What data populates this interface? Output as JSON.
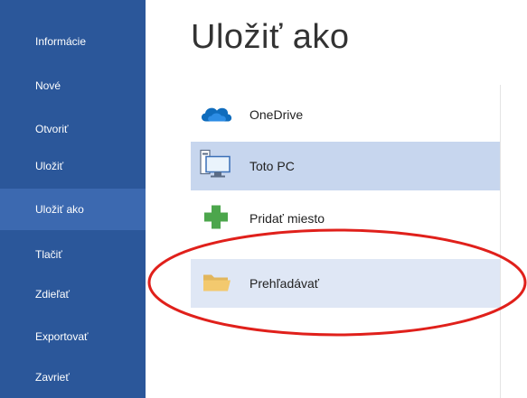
{
  "sidebar": {
    "items": [
      {
        "label": "Informácie"
      },
      {
        "label": "Nové"
      },
      {
        "label": "Otvoriť"
      },
      {
        "label": "Uložiť"
      },
      {
        "label": "Uložiť ako"
      },
      {
        "label": "Tlačiť"
      },
      {
        "label": "Zdieľať"
      },
      {
        "label": "Exportovať"
      },
      {
        "label": "Zavrieť"
      }
    ],
    "active": "Uložiť ako",
    "color": "#2b579a"
  },
  "main": {
    "title": "Uložiť ako",
    "locations": [
      {
        "label": "OneDrive",
        "icon": "onedrive-cloud-icon"
      },
      {
        "label": "Toto PC",
        "icon": "computer-icon"
      },
      {
        "label": "Pridať miesto",
        "icon": "plus-icon"
      },
      {
        "label": "Prehľadávať",
        "icon": "folder-icon"
      }
    ],
    "annotation_color": "#e0201b"
  }
}
